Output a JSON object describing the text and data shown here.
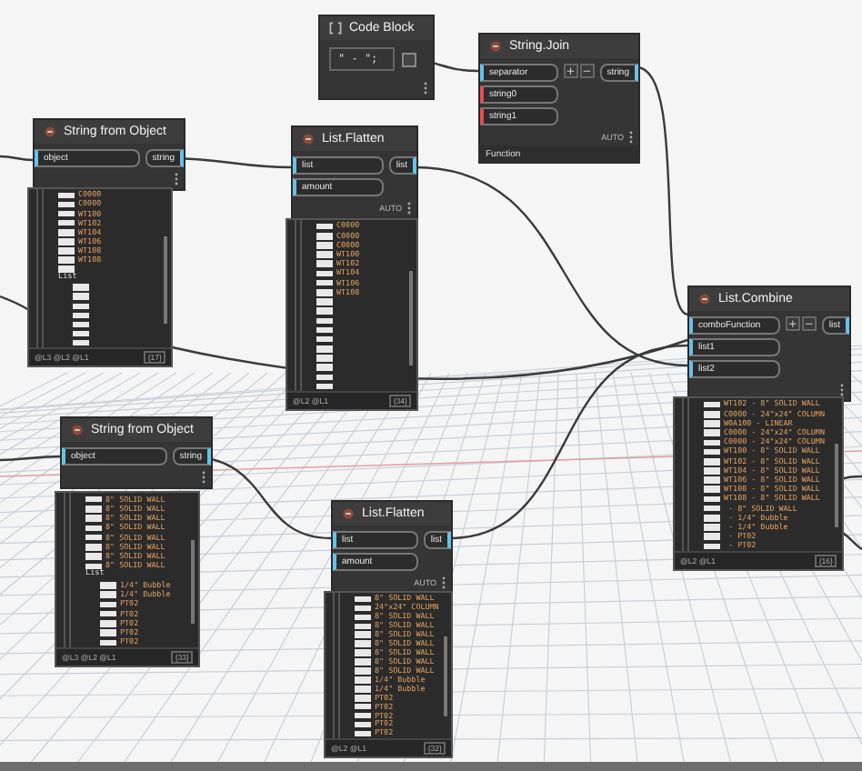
{
  "canvas": {
    "nodes": [
      {
        "kind": "code",
        "title": "Code Block",
        "code": "\" - \";"
      },
      {
        "kind": "function",
        "title": "String.Join",
        "inputs": [
          {
            "name": "separator",
            "connected": true
          },
          {
            "name": "string0",
            "connected": false
          },
          {
            "name": "string1",
            "connected": false
          }
        ],
        "list_buttons": [
          "+",
          "−"
        ],
        "outputs": [
          "string"
        ],
        "lacing": "AUTO",
        "status": "Function"
      },
      {
        "kind": "function",
        "title": "String from Object",
        "inputs": [
          {
            "name": "object",
            "connected": true
          }
        ],
        "outputs": [
          "string"
        ],
        "preview": {
          "rows": [
            {
              "kind": "item",
              "text": "C0000"
            },
            {
              "kind": "item",
              "text": "C0000"
            },
            {
              "kind": "item",
              "text": "WT100"
            },
            {
              "kind": "item",
              "text": "WT102"
            },
            {
              "kind": "item",
              "text": "WT104"
            },
            {
              "kind": "item",
              "text": "WT106"
            },
            {
              "kind": "item",
              "text": "WT108"
            },
            {
              "kind": "item",
              "text": "WT108"
            },
            {
              "kind": "blank"
            },
            {
              "kind": "list",
              "text": "List"
            },
            {
              "kind": "blank"
            },
            {
              "kind": "blank"
            },
            {
              "kind": "blank"
            },
            {
              "kind": "blank"
            },
            {
              "kind": "blank"
            },
            {
              "kind": "blank"
            },
            {
              "kind": "blank"
            }
          ],
          "levels": "@L3 @L2 @L1",
          "count": "{17}"
        }
      },
      {
        "kind": "function",
        "title": "List.Flatten",
        "inputs": [
          {
            "name": "list",
            "connected": true
          },
          {
            "name": "amount",
            "connected": true
          }
        ],
        "outputs": [
          "list"
        ],
        "lacing": "AUTO",
        "preview": {
          "rows": [
            {
              "kind": "item",
              "text": "C0000"
            },
            {
              "kind": "item",
              "text": "C0000"
            },
            {
              "kind": "item",
              "text": "C0000"
            },
            {
              "kind": "item",
              "text": "WT100"
            },
            {
              "kind": "item",
              "text": "WT102"
            },
            {
              "kind": "item",
              "text": "WT104"
            },
            {
              "kind": "item",
              "text": "WT106"
            },
            {
              "kind": "item",
              "text": "WT108"
            },
            {
              "kind": "blank"
            },
            {
              "kind": "blank"
            },
            {
              "kind": "blank"
            },
            {
              "kind": "blank"
            },
            {
              "kind": "blank"
            },
            {
              "kind": "blank"
            },
            {
              "kind": "blank"
            },
            {
              "kind": "blank"
            },
            {
              "kind": "blank"
            },
            {
              "kind": "blank"
            }
          ],
          "levels": "@L2 @L1",
          "count": "{34}"
        }
      },
      {
        "kind": "function",
        "title": "List.Combine",
        "inputs": [
          {
            "name": "comboFunction",
            "connected": true
          },
          {
            "name": "list1",
            "connected": true
          },
          {
            "name": "list2",
            "connected": true
          }
        ],
        "list_buttons": [
          "+",
          "−"
        ],
        "outputs": [
          "list"
        ],
        "preview": {
          "rows": [
            {
              "kind": "item",
              "text": "WT102 - 8\" SOLID WALL"
            },
            {
              "kind": "item",
              "text": "C0000 - 24\"x24\" COLUMN"
            },
            {
              "kind": "item",
              "text": "W0A100 - LINEAR"
            },
            {
              "kind": "item",
              "text": "C0000 - 24\"x24\" COLUMN"
            },
            {
              "kind": "item",
              "text": "C0000 - 24\"x24\" COLUMN"
            },
            {
              "kind": "item",
              "text": "WT100 - 8\" SOLID WALL"
            },
            {
              "kind": "item",
              "text": "WT102 - 8\" SOLID WALL"
            },
            {
              "kind": "item",
              "text": "WT104 - 8\" SOLID WALL"
            },
            {
              "kind": "item",
              "text": "WT106 - 8\" SOLID WALL"
            },
            {
              "kind": "item",
              "text": "WT108 - 8\" SOLID WALL"
            },
            {
              "kind": "item",
              "text": "WT108 - 8\" SOLID WALL"
            },
            {
              "kind": "item",
              "text": " - 8\" SOLID WALL"
            },
            {
              "kind": "item",
              "text": " - 1/4\" Bubble"
            },
            {
              "kind": "item",
              "text": " - 1/4\" Bubble"
            },
            {
              "kind": "item",
              "text": " - PT02"
            },
            {
              "kind": "item",
              "text": " - PT02"
            }
          ],
          "levels": "@L2 @L1",
          "count": "{16}"
        }
      },
      {
        "kind": "function",
        "title": "String from Object",
        "inputs": [
          {
            "name": "object",
            "connected": true
          }
        ],
        "outputs": [
          "string"
        ],
        "preview": {
          "rows": [
            {
              "kind": "item",
              "text": "8\" SOLID WALL"
            },
            {
              "kind": "item",
              "text": "8\" SOLID WALL"
            },
            {
              "kind": "item",
              "text": "8\" SOLID WALL"
            },
            {
              "kind": "item",
              "text": "8\" SOLID WALL"
            },
            {
              "kind": "item",
              "text": "8\" SOLID WALL"
            },
            {
              "kind": "item",
              "text": "8\" SOLID WALL"
            },
            {
              "kind": "item",
              "text": "8\" SOLID WALL"
            },
            {
              "kind": "item",
              "text": "8\" SOLID WALL"
            },
            {
              "kind": "list",
              "text": "List"
            },
            {
              "kind": "item",
              "text": "1/4\" Bubble"
            },
            {
              "kind": "item",
              "text": "1/4\" Bubble"
            },
            {
              "kind": "item",
              "text": "PT02"
            },
            {
              "kind": "item",
              "text": "PT02"
            },
            {
              "kind": "item",
              "text": "PT02"
            },
            {
              "kind": "item",
              "text": "PT02"
            },
            {
              "kind": "item",
              "text": "PT02"
            }
          ],
          "levels": "@L3 @L2 @L1",
          "count": "{33}"
        }
      },
      {
        "kind": "function",
        "title": "List.Flatten",
        "inputs": [
          {
            "name": "list",
            "connected": true
          },
          {
            "name": "amount",
            "connected": true
          }
        ],
        "outputs": [
          "list"
        ],
        "lacing": "AUTO",
        "preview": {
          "rows": [
            {
              "kind": "item",
              "text": "8\" SOLID WALL"
            },
            {
              "kind": "item",
              "text": "24\"x24\" COLUMN"
            },
            {
              "kind": "item",
              "text": "8\" SOLID WALL"
            },
            {
              "kind": "item",
              "text": "8\" SOLID WALL"
            },
            {
              "kind": "item",
              "text": "8\" SOLID WALL"
            },
            {
              "kind": "item",
              "text": "8\" SOLID WALL"
            },
            {
              "kind": "item",
              "text": "8\" SOLID WALL"
            },
            {
              "kind": "item",
              "text": "8\" SOLID WALL"
            },
            {
              "kind": "item",
              "text": "8\" SOLID WALL"
            },
            {
              "kind": "item",
              "text": "1/4\" Bubble"
            },
            {
              "kind": "item",
              "text": "1/4\" Bubble"
            },
            {
              "kind": "item",
              "text": "PT02"
            },
            {
              "kind": "item",
              "text": "PT02"
            },
            {
              "kind": "item",
              "text": "PT02"
            },
            {
              "kind": "item",
              "text": "PT02"
            },
            {
              "kind": "item",
              "text": "PT02"
            }
          ],
          "levels": "@L2 @L1",
          "count": "{32}"
        }
      }
    ]
  }
}
